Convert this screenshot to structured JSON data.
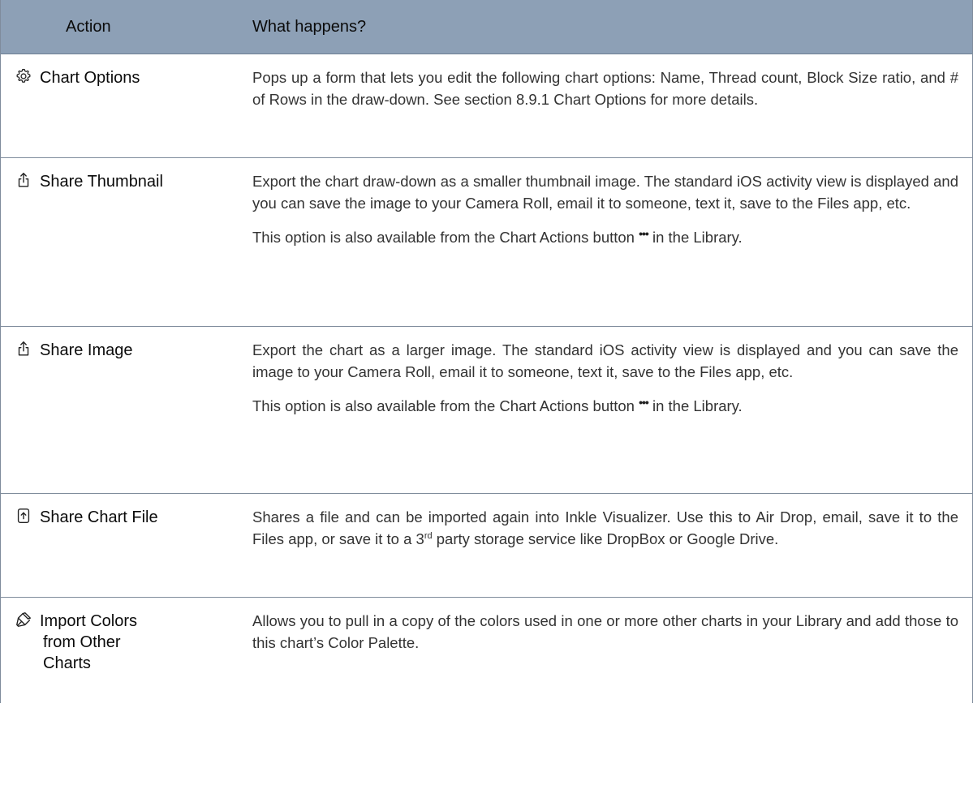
{
  "header": {
    "action": "Action",
    "what": "What happens?"
  },
  "rows": [
    {
      "icon": "gear-icon",
      "action": "Chart Options",
      "paragraphs": [
        "Pops up a form that lets you edit the following chart options: Name, Thread count, Block Size ratio, and # of Rows in the draw-down. See section 8.9.1 Chart Options for more details."
      ]
    },
    {
      "icon": "share-icon",
      "action": "Share Thumbnail",
      "paragraphs": [
        "Export the chart draw-down as a smaller thumbnail image. The standard iOS activity view is displayed and you can save the image to your Camera Roll, email it to someone, text it, save to the Files app, etc."
      ],
      "note_before": "This option is also available from the Chart Actions button",
      "note_dots": "•••",
      "note_after": "in the Library."
    },
    {
      "icon": "share-icon",
      "action": "Share Image",
      "paragraphs": [
        "Export the chart as a larger image. The standard iOS activity view is displayed and you can save the image to your Camera Roll, email it to someone, text it, save to the Files app, etc."
      ],
      "note_before": "This option is also available from the Chart Actions button",
      "note_dots": "•••",
      "note_after": "in the Library."
    },
    {
      "icon": "file-upload-icon",
      "action": "Share Chart File",
      "text_before": "Shares a file and can be imported again into Inkle Visualizer.  Use this to Air Drop, email, save it to the Files app, or save it to a 3",
      "text_sup": "rd",
      "text_after": " party storage service like DropBox or Google Drive."
    },
    {
      "icon": "paint-dropper-icon",
      "action_lines": [
        "Import Colors",
        "from Other",
        "Charts"
      ],
      "paragraphs": [
        "Allows you to pull in a copy of the colors used in one or more other charts in your Library and add those to this chart’s Color Palette."
      ]
    }
  ]
}
